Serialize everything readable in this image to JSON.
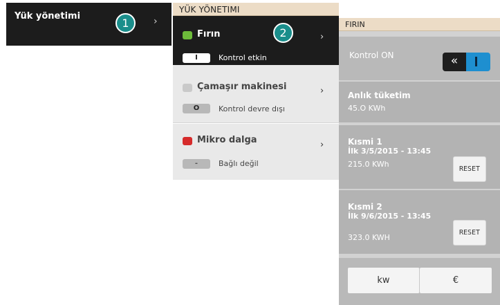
{
  "callouts": [
    "1",
    "2"
  ],
  "menu": {
    "title": "Yük yönetimi",
    "chevron": "›"
  },
  "loads_panel": {
    "header": "YÜK YÖNETIMI",
    "devices": [
      {
        "name": "Fırın",
        "status_chip": "I",
        "status_text": "Kontrol etkin",
        "indicator_color": "#6dbb3a"
      },
      {
        "name": "Çamaşır makinesi",
        "status_chip": "O",
        "status_text": "Kontrol devre dışı",
        "indicator_color": "#c9c9c9"
      },
      {
        "name": "Mikro dalga",
        "status_chip": "-",
        "status_text": "Bağlı değil",
        "indicator_color": "#d62b2b"
      }
    ],
    "chevron": "›"
  },
  "detail": {
    "header": "FIRIN",
    "control_label": "Kontrol ON",
    "toggle_left_glyph": "«",
    "instant": {
      "title": "Anlık tüketim",
      "value": "45.O KWh"
    },
    "partials": [
      {
        "title": "Kısmi 1",
        "date": "İlk  3/5/2015 - 13:45",
        "value": "215.0 KWh",
        "reset": "RESET"
      },
      {
        "title": "Kısmi 2",
        "date": "İlk  9/6/2015 - 13:45",
        "value": "323.0 KWH",
        "reset": "RESET"
      }
    ],
    "units": {
      "kw": "kw",
      "eur": "€"
    }
  },
  "colors": {
    "accent_teal": "#1a8e8b",
    "toggle_blue": "#1e8fd0",
    "header_beige": "#ecdcc6"
  }
}
